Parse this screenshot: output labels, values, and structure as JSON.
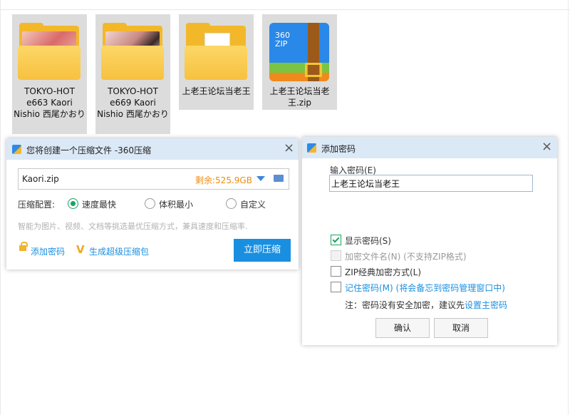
{
  "files": [
    {
      "name": "TOKYO-HOT e663 Kaori Nishio 西尾かおり",
      "type": "folder-photo"
    },
    {
      "name": "TOKYO-HOT e669 Kaori Nishio 西尾かおり",
      "type": "folder-photo"
    },
    {
      "name": "上老王论坛当老王",
      "type": "folder-doc"
    },
    {
      "name": "上老王论坛当老王.zip",
      "type": "zip-archive",
      "zip_icon_text": "360\nZIP"
    }
  ],
  "compress_dialog": {
    "title": "您将创建一个压缩文件 -360压缩",
    "filename": "Kaori.zip",
    "remaining": "剩余:525.9GB",
    "config_label": "压缩配置:",
    "options": [
      "速度最快",
      "体积最小",
      "自定义"
    ],
    "selected_option": "速度最快",
    "hint": "智能为图片、视频、文档等挑选最优压缩方式，兼具速度和压缩率.",
    "add_password": "添加密码",
    "super_package": "生成超级压缩包",
    "compress_now": "立即压缩"
  },
  "password_dialog": {
    "title": "添加密码",
    "input_label": "输入密码(E)",
    "password_value": "上老王论坛当老王",
    "options": [
      {
        "label": "显示密码(S)",
        "checked": true,
        "enabled": true
      },
      {
        "label": "加密文件名(N) (不支持ZIP格式)",
        "checked": false,
        "enabled": false
      },
      {
        "label": "ZIP经典加密方式(L)",
        "checked": false,
        "enabled": true
      },
      {
        "label": "记住密码(M) (将会备忘到密码管理窗口中)",
        "checked": false,
        "enabled": true
      }
    ],
    "note": "注：密码没有安全加密，建议先",
    "note_link": "设置主密码",
    "ok": "确认",
    "cancel": "取消"
  },
  "colors": {
    "accent_blue": "#1a8fe0",
    "orange": "#ec8c12",
    "green": "#1aa260",
    "titlebar": "#dbe8f6"
  }
}
